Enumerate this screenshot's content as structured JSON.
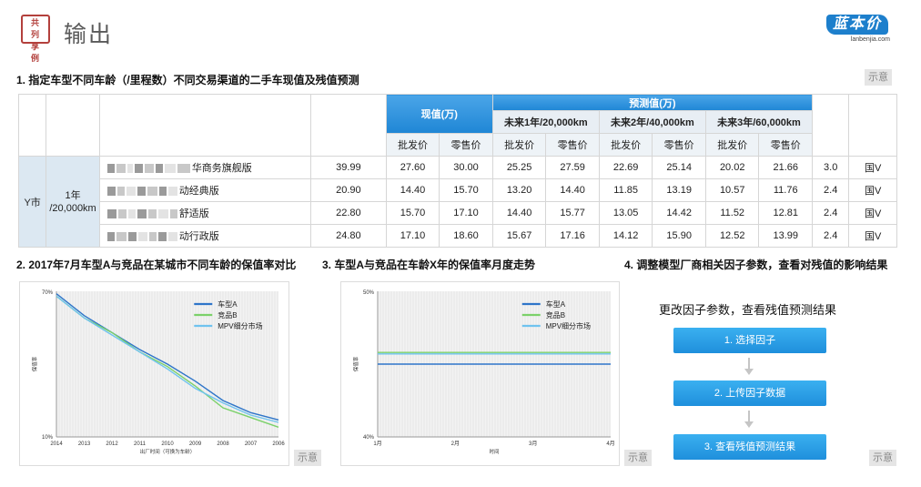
{
  "header": {
    "seal_chars": [
      "共",
      "列",
      "享",
      "例"
    ],
    "title": "输出",
    "logo_text": "蓝本价",
    "logo_url": "lanbenjia.com"
  },
  "section1": {
    "title": "1. 指定车型不同车龄（/里程数）不同交易渠道的二手车现值及残值预测",
    "hint": "示意",
    "table": {
      "current_value_label": "现值(万)",
      "forecast_label": "预测值(万)",
      "periods": [
        "未来1年/20,000km",
        "未来2年/40,000km",
        "未来3年/60,000km"
      ],
      "wholesale": "批发价",
      "retail": "零售价",
      "city": "Y市",
      "age_line1": "1年",
      "age_line2": "/20,000km",
      "rows": [
        {
          "model": "华商务旗舰版",
          "price": "39.99",
          "cur_w": "27.60",
          "cur_r": "30.00",
          "y1_w": "25.25",
          "y1_r": "27.59",
          "y2_w": "22.69",
          "y2_r": "25.14",
          "y3_w": "20.02",
          "y3_r": "21.66",
          "disp": "3.0",
          "std": "国V"
        },
        {
          "model": "动经典版",
          "price": "20.90",
          "cur_w": "14.40",
          "cur_r": "15.70",
          "y1_w": "13.20",
          "y1_r": "14.40",
          "y2_w": "11.85",
          "y2_r": "13.19",
          "y3_w": "10.57",
          "y3_r": "11.76",
          "disp": "2.4",
          "std": "国V"
        },
        {
          "model": "舒适版",
          "price": "22.80",
          "cur_w": "15.70",
          "cur_r": "17.10",
          "y1_w": "14.40",
          "y1_r": "15.77",
          "y2_w": "13.05",
          "y2_r": "14.42",
          "y3_w": "11.52",
          "y3_r": "12.81",
          "disp": "2.4",
          "std": "国V"
        },
        {
          "model": "动行政版",
          "price": "24.80",
          "cur_w": "17.10",
          "cur_r": "18.60",
          "y1_w": "15.67",
          "y1_r": "17.16",
          "y2_w": "14.12",
          "y2_r": "15.90",
          "y3_w": "12.52",
          "y3_r": "13.99",
          "disp": "2.4",
          "std": "国V"
        }
      ]
    }
  },
  "section2": {
    "title": "2. 2017年7月车型A与竞品在某城市不同车龄的保值率对比",
    "hint": "示意"
  },
  "section3": {
    "title": "3. 车型A与竞品在车龄X年的保值率月度走势",
    "hint": "示意"
  },
  "section4": {
    "title": "4. 调整模型厂商相关因子参数，查看对残值的影响结果",
    "hint": "示意",
    "flow_title": "更改因子参数，查看残值预测结果",
    "steps": [
      "1. 选择因子",
      "2. 上传因子数据",
      "3. 查看残值预测结果"
    ]
  },
  "chart_data": [
    {
      "type": "line",
      "ylabel": "保值率",
      "xlabel": "出厂时间（可换为车龄）",
      "categories": [
        "2014",
        "2013",
        "2012",
        "2011",
        "2010",
        "2009",
        "2008",
        "2007",
        "2006"
      ],
      "y_ticks": [
        "70%",
        "10%"
      ],
      "ylim": [
        10,
        70
      ],
      "grid": true,
      "legend": "top-right",
      "series": [
        {
          "name": "车型A",
          "color": "#2e75c9",
          "values": [
            69,
            60,
            53,
            46,
            40,
            33,
            25,
            20,
            17
          ]
        },
        {
          "name": "竞品B",
          "color": "#7bd16a",
          "values": [
            68,
            59,
            53,
            45,
            39,
            31,
            22,
            18,
            14
          ]
        },
        {
          "name": "MPV细分市场",
          "color": "#6fc3ef",
          "values": [
            68,
            59,
            52,
            45,
            38,
            30,
            24,
            19,
            16
          ]
        }
      ]
    },
    {
      "type": "line",
      "ylabel": "保值率",
      "xlabel": "时间",
      "categories": [
        "1月",
        "2月",
        "3月",
        "4月"
      ],
      "y_ticks": [
        "50%",
        "40%"
      ],
      "ylim": [
        40,
        50
      ],
      "grid": true,
      "legend": "top-right",
      "series": [
        {
          "name": "车型A",
          "color": "#2e75c9",
          "values": [
            45,
            45,
            45,
            45
          ]
        },
        {
          "name": "竞品B",
          "color": "#7bd16a",
          "values": [
            45.8,
            45.8,
            45.8,
            45.8
          ]
        },
        {
          "name": "MPV细分市场",
          "color": "#6fc3ef",
          "values": [
            45.7,
            45.7,
            45.7,
            45.7
          ]
        }
      ]
    }
  ]
}
